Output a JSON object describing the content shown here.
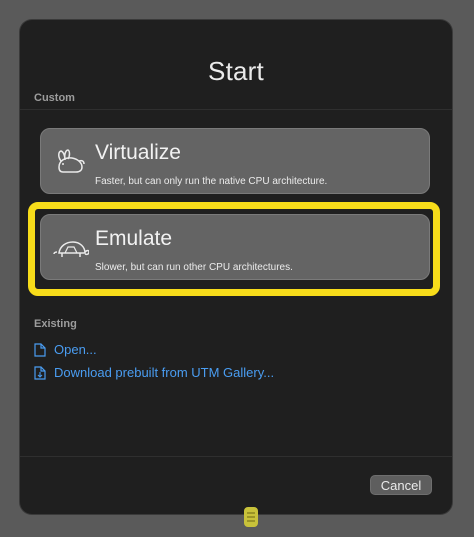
{
  "dialog": {
    "title": "Start",
    "custom_label": "Custom",
    "existing_label": "Existing",
    "cancel_label": "Cancel"
  },
  "options": [
    {
      "title": "Virtualize",
      "subtitle": "Faster, but can only run the native CPU architecture.",
      "icon": "rabbit-icon"
    },
    {
      "title": "Emulate",
      "subtitle": "Slower, but can run other CPU architectures.",
      "icon": "turtle-icon"
    }
  ],
  "links": [
    {
      "label": "Open...",
      "icon": "document-icon"
    },
    {
      "label": "Download prebuilt from UTM Gallery...",
      "icon": "download-document-icon"
    }
  ],
  "colors": {
    "highlight": "#f7dc1a",
    "link": "#4a9df2",
    "card": "#646464",
    "dialog_bg": "#1f1f1f"
  }
}
